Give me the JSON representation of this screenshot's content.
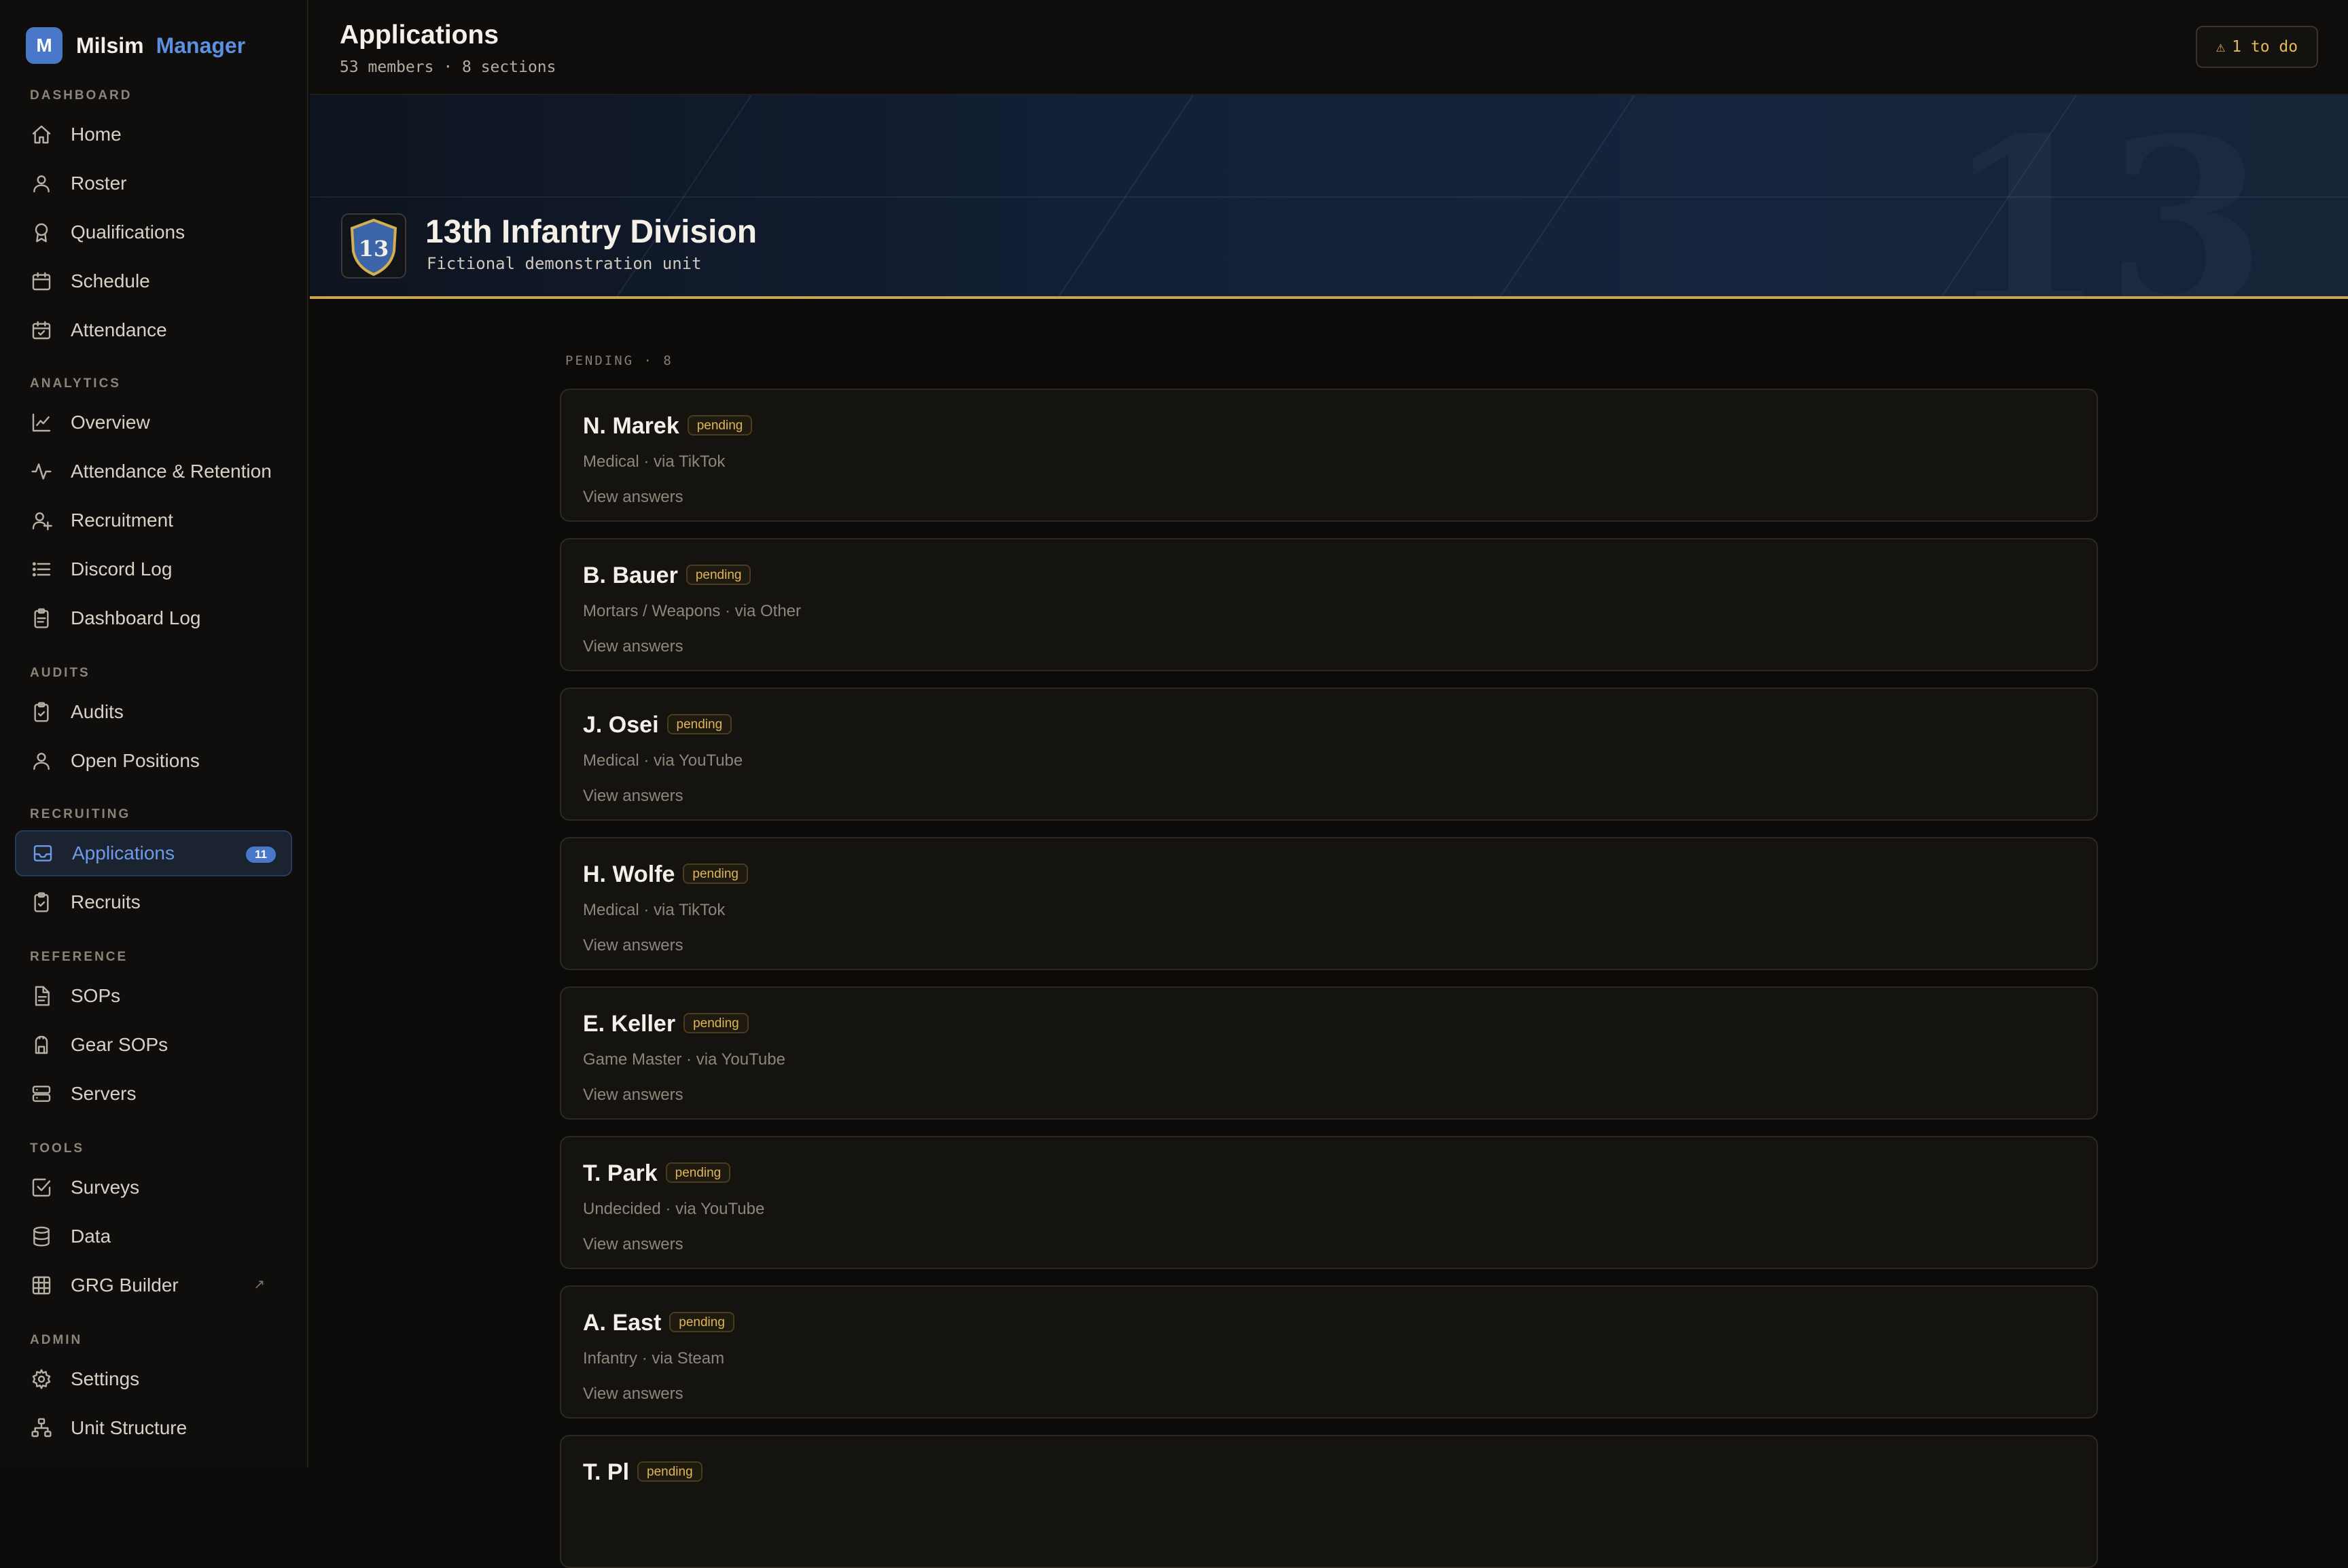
{
  "brand": {
    "logo_letter": "M",
    "name": "Milsim",
    "accent": "Manager"
  },
  "sidebar": {
    "sections": [
      {
        "heading": "DASHBOARD",
        "items": [
          {
            "label": "Home",
            "icon": "home-icon"
          },
          {
            "label": "Roster",
            "icon": "user-icon"
          },
          {
            "label": "Qualifications",
            "icon": "award-icon"
          },
          {
            "label": "Schedule",
            "icon": "calendar-icon"
          },
          {
            "label": "Attendance",
            "icon": "calendar-check-icon"
          }
        ]
      },
      {
        "heading": "ANALYTICS",
        "items": [
          {
            "label": "Overview",
            "icon": "line-chart-icon"
          },
          {
            "label": "Attendance & Retention",
            "icon": "activity-icon"
          },
          {
            "label": "Recruitment",
            "icon": "user-plus-icon"
          },
          {
            "label": "Discord Log",
            "icon": "list-icon"
          },
          {
            "label": "Dashboard Log",
            "icon": "clipboard-icon"
          }
        ]
      },
      {
        "heading": "AUDITS",
        "items": [
          {
            "label": "Audits",
            "icon": "clipboard-check-icon"
          },
          {
            "label": "Open Positions",
            "icon": "user-icon"
          }
        ]
      },
      {
        "heading": "RECRUITING",
        "items": [
          {
            "label": "Applications",
            "icon": "inbox-icon",
            "badge": "11",
            "active": true
          },
          {
            "label": "Recruits",
            "icon": "clipboard-check-icon"
          }
        ]
      },
      {
        "heading": "REFERENCE",
        "items": [
          {
            "label": "SOPs",
            "icon": "file-icon"
          },
          {
            "label": "Gear SOPs",
            "icon": "backpack-icon"
          },
          {
            "label": "Servers",
            "icon": "server-icon"
          }
        ]
      },
      {
        "heading": "TOOLS",
        "items": [
          {
            "label": "Surveys",
            "icon": "check-square-icon"
          },
          {
            "label": "Data",
            "icon": "database-icon"
          },
          {
            "label": "GRG Builder",
            "icon": "grid-icon",
            "external": "↗"
          }
        ]
      },
      {
        "heading": "ADMIN",
        "items": [
          {
            "label": "Settings",
            "icon": "gear-icon"
          },
          {
            "label": "Unit Structure",
            "icon": "org-chart-icon"
          }
        ]
      }
    ]
  },
  "header": {
    "title": "Applications",
    "subtitle": "53 members · 8 sections",
    "todo_icon": "warning-icon",
    "todo_label": "1 to do"
  },
  "banner": {
    "unit_name": "13th Infantry Division",
    "unit_desc": "Fictional demonstration unit",
    "emblem_number": "13",
    "watermark": "13"
  },
  "pending": {
    "label": "PENDING · 8",
    "applications": [
      {
        "name": "N. Marek",
        "status": "pending",
        "meta": "Medical · via TikTok",
        "link": "View answers"
      },
      {
        "name": "B. Bauer",
        "status": "pending",
        "meta": "Mortars / Weapons · via Other",
        "link": "View answers"
      },
      {
        "name": "J. Osei",
        "status": "pending",
        "meta": "Medical · via YouTube",
        "link": "View answers"
      },
      {
        "name": "H. Wolfe",
        "status": "pending",
        "meta": "Medical · via TikTok",
        "link": "View answers"
      },
      {
        "name": "E. Keller",
        "status": "pending",
        "meta": "Game Master · via YouTube",
        "link": "View answers"
      },
      {
        "name": "T. Park",
        "status": "pending",
        "meta": "Undecided · via YouTube",
        "link": "View answers"
      },
      {
        "name": "A. East",
        "status": "pending",
        "meta": "Infantry · via Steam",
        "link": "View answers"
      },
      {
        "name": "T. Pl",
        "status": "pending",
        "meta": "",
        "link": ""
      }
    ]
  },
  "colors": {
    "accent": "#5d8fe0",
    "gold": "#c9a54f",
    "pending": "#e0b557",
    "background": "#0c0b09"
  }
}
